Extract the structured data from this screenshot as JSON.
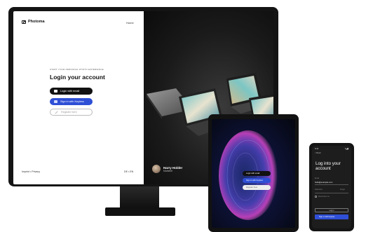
{
  "desktop": {
    "brand": "Photoma",
    "home_link": "Home",
    "kicker": "START YOUR PERSONAL PHOTO EXPERIENCE",
    "title": "Login your account",
    "buttons": {
      "email": "Login with email",
      "keyless": "Sign in with Keyless",
      "register": "Register here"
    },
    "footer_left": "Imprint • Privacy",
    "footer_right": "DE • EN",
    "person": {
      "name": "Harry Holder",
      "role": "Marketer"
    }
  },
  "tablet": {
    "buttons": {
      "email": "Login with email",
      "keyless": "Sign in with Keyless",
      "register": "Register here"
    }
  },
  "phone": {
    "status_time": "9:41",
    "status_icons": "▾◢▮",
    "back": "< Back",
    "title": "Log into your account",
    "email_label": "Email",
    "email_value": "hello@example.com",
    "password_label": "Password",
    "forgot": "Forgot",
    "remember": "Remember me",
    "login_button": "Log in",
    "keyless_button": "Sign in with Keyless"
  },
  "colors": {
    "accent_blue": "#2f4fd6",
    "dark": "#111111",
    "panel_white": "#ffffff"
  }
}
